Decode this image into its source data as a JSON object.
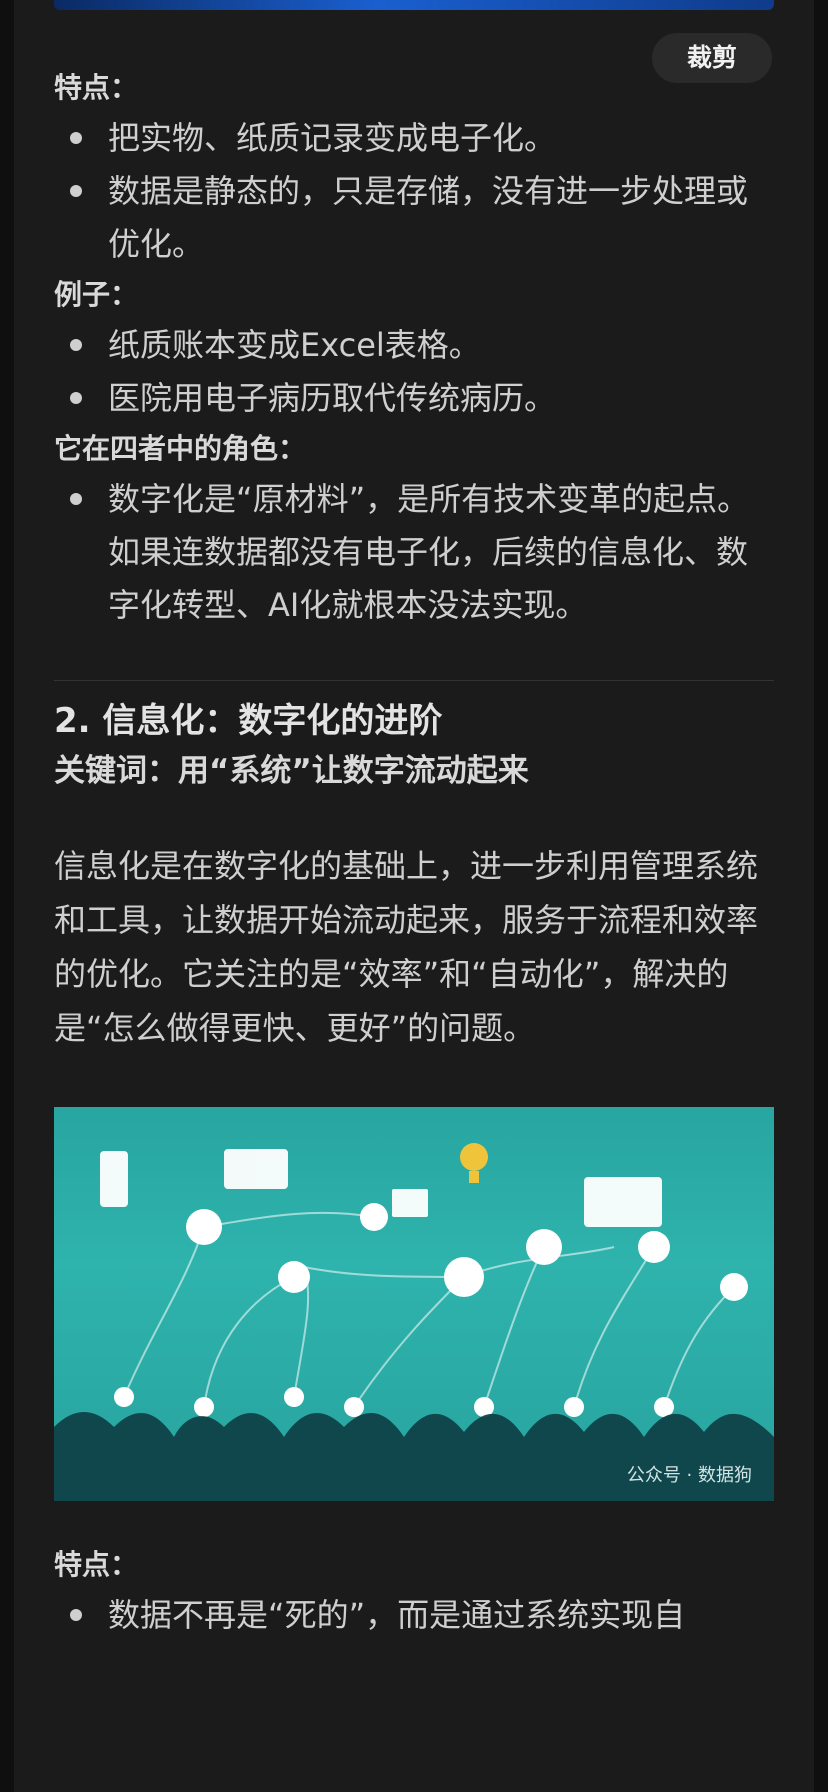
{
  "toolbar": {
    "crop_label": "裁剪"
  },
  "section_digital": {
    "features_label": "特点：",
    "features": [
      "把实物、纸质记录变成电子化。",
      "数据是静态的，只是存储，没有进一步处理或优化。"
    ],
    "examples_label": "例子：",
    "examples": [
      "纸质账本变成Excel表格。",
      "医院用电子病历取代传统病历。"
    ],
    "role_label": "它在四者中的角色：",
    "role": [
      "数字化是“原材料”，是所有技术变革的起点。如果连数据都没有电子化，后续的信息化、数字化转型、AI化就根本没法实现。"
    ]
  },
  "section_info": {
    "title": "2. 信息化：数字化的进阶",
    "keyword": "关键词：用“系统”让数字流动起来",
    "paragraph": "信息化是在数字化的基础上，进一步利用管理系统和工具，让数据开始流动起来，服务于流程和效率的优化。它关注的是“效率”和“自动化”，解决的是“怎么做得更快、更好”的问题。",
    "image_watermark": "公众号 · 数据狗",
    "features_label": "特点：",
    "features_partial": "数据不再是“死的”，而是通过系统实现自"
  },
  "colors": {
    "background": "#1b1b1b",
    "text": "#cfcfcf",
    "figure_bg": "#2fb3ad"
  }
}
